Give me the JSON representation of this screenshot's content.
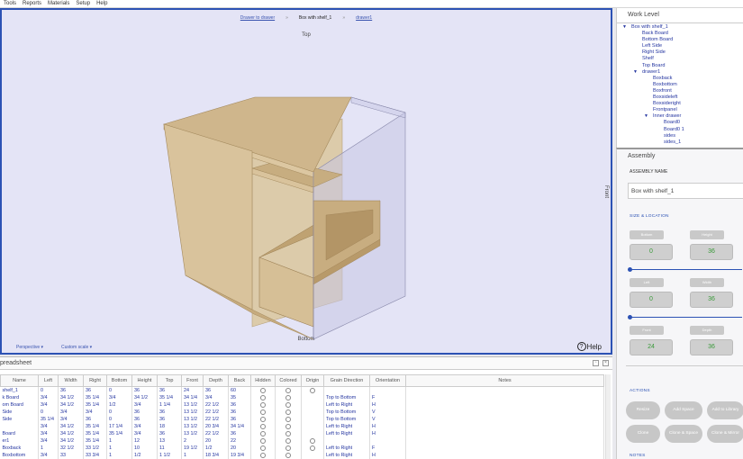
{
  "menu": [
    "Tools",
    "Reports",
    "Materials",
    "Setup",
    "Help"
  ],
  "viewport": {
    "breadcrumbs": [
      "Drawer to drawer",
      "Box with shelf_1",
      "drawer1"
    ],
    "top_label": "Top",
    "bottom_label": "Bottom",
    "front_label": "Front",
    "perspective": "Perspective",
    "scale": "Custom scale",
    "help": "Help",
    "help_icon": "?"
  },
  "work_level": {
    "title": "Work Level",
    "tree": [
      {
        "label": "Box with shelf_1",
        "indent": 0,
        "expanded": true
      },
      {
        "label": "Back Board",
        "indent": 1
      },
      {
        "label": "Bottom Board",
        "indent": 1
      },
      {
        "label": "Left Side",
        "indent": 1
      },
      {
        "label": "Right Side",
        "indent": 1
      },
      {
        "label": "Shelf",
        "indent": 1
      },
      {
        "label": "Top Board",
        "indent": 1
      },
      {
        "label": "drawer1",
        "indent": 1,
        "expanded": true
      },
      {
        "label": "Boxback",
        "indent": 2
      },
      {
        "label": "Boxbottom",
        "indent": 2
      },
      {
        "label": "Boxfront",
        "indent": 2
      },
      {
        "label": "Boxsideleft",
        "indent": 2
      },
      {
        "label": "Boxsideright",
        "indent": 2
      },
      {
        "label": "Frontpanel",
        "indent": 2
      },
      {
        "label": "Inner drawer",
        "indent": 2,
        "expanded": true
      },
      {
        "label": "Board0",
        "indent": 3
      },
      {
        "label": "Board0 1",
        "indent": 3
      },
      {
        "label": "sides",
        "indent": 3
      },
      {
        "label": "sides_1",
        "indent": 3
      }
    ]
  },
  "assembly": {
    "title": "Assembly",
    "name_label": "ASSEMBLY NAME",
    "name_value": "Box with shelf_1",
    "size_section": "SIZE & LOCATION",
    "fields": [
      {
        "label": "Bottom",
        "value": "0"
      },
      {
        "label": "Height",
        "value": "36"
      },
      {
        "label": "Left",
        "value": "0"
      },
      {
        "label": "Width",
        "value": "36"
      },
      {
        "label": "Front",
        "value": "24"
      },
      {
        "label": "Depth",
        "value": "36"
      }
    ],
    "actions_label": "ACTIONS",
    "actions": [
      "Resize",
      "Add Space",
      "Add to Library",
      "Clone",
      "Clone & Space",
      "Clone & Mirror"
    ],
    "notes_label": "NOTES"
  },
  "spreadsheet": {
    "title": "preadsheet",
    "columns": [
      "Name",
      "Left",
      "Width",
      "Right",
      "Bottom",
      "Height",
      "Top",
      "Front",
      "Depth",
      "Back",
      "Hidden",
      "Colored",
      "Origin",
      "Grain Direction",
      "Orientation",
      "Notes"
    ],
    "rows": [
      [
        "shelf_1",
        "0",
        "36",
        "36",
        "0",
        "36",
        "36",
        "24",
        "36",
        "60",
        "",
        "",
        "",
        "",
        "",
        ""
      ],
      [
        "k Board",
        "3/4",
        "34 1/2",
        "35 1/4",
        "3/4",
        "34 1/2",
        "35 1/4",
        "34 1/4",
        "3/4",
        "35",
        "",
        "",
        "",
        "Top to Bottom",
        "F",
        ""
      ],
      [
        "om Board",
        "3/4",
        "34 1/2",
        "35 1/4",
        "1/2",
        "3/4",
        "1 1/4",
        "13 1/2",
        "22 1/2",
        "36",
        "",
        "",
        "",
        "Left to Right",
        "H",
        ""
      ],
      [
        "Side",
        "0",
        "3/4",
        "3/4",
        "0",
        "36",
        "36",
        "13 1/2",
        "22 1/2",
        "36",
        "",
        "",
        "",
        "Top to Bottom",
        "V",
        ""
      ],
      [
        "Side",
        "35 1/4",
        "3/4",
        "36",
        "0",
        "36",
        "36",
        "13 1/2",
        "22 1/2",
        "36",
        "",
        "",
        "",
        "Top to Bottom",
        "V",
        ""
      ],
      [
        "",
        "3/4",
        "34 1/2",
        "35 1/4",
        "17 1/4",
        "3/4",
        "18",
        "13 1/2",
        "20 3/4",
        "34 1/4",
        "",
        "",
        "",
        "Left to Right",
        "H",
        ""
      ],
      [
        "Board",
        "3/4",
        "34 1/2",
        "35 1/4",
        "35 1/4",
        "3/4",
        "36",
        "13 1/2",
        "22 1/2",
        "36",
        "",
        "",
        "",
        "Left to Right",
        "H",
        ""
      ],
      [
        "er1",
        "3/4",
        "34 1/2",
        "35 1/4",
        "1",
        "12",
        "13",
        "2",
        "20",
        "22",
        "",
        "",
        "",
        "",
        "",
        ""
      ],
      [
        "Boxback",
        "1",
        "32 1/2",
        "33 1/2",
        "1",
        "10",
        "11",
        "19 1/2",
        "1/2",
        "20",
        "",
        "",
        "",
        "Left to Right",
        "F",
        ""
      ],
      [
        "Boxbottom",
        "3/4",
        "33",
        "33 3/4",
        "1",
        "1/2",
        "1 1/2",
        "1",
        "18 3/4",
        "19 3/4",
        "",
        "",
        "",
        "Left to Right",
        "H",
        ""
      ]
    ],
    "checks": [
      [
        true,
        true,
        true
      ],
      [
        true,
        true,
        false
      ],
      [
        true,
        true,
        false
      ],
      [
        true,
        true,
        false
      ],
      [
        true,
        true,
        false
      ],
      [
        true,
        true,
        false
      ],
      [
        true,
        true,
        false
      ],
      [
        true,
        true,
        true
      ],
      [
        true,
        true,
        true
      ],
      [
        true,
        true,
        false
      ]
    ]
  },
  "colors": {
    "accent": "#2c52b4",
    "tree_text": "#2435a0",
    "wood": "#d2b991",
    "field_value": "#3a9a3a"
  }
}
